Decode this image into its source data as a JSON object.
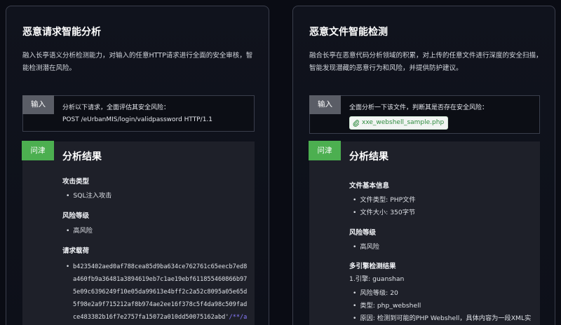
{
  "left": {
    "title": "恶意请求智能分析",
    "desc": "融入长亭语义分析检测能力，对输入的任意HTTP请求进行全面的安全审核，智能检测潜在风险。",
    "input_tag": "输入",
    "input_line1": "分析以下请求，全面评估其安全风险：",
    "input_line2": "POST /eUrbanMIS/login/validpassword HTTP/1.1",
    "answer_tag": "问津",
    "result_title": "分析结果",
    "attack_type_label": "攻击类型",
    "attack_type_value": "SQL注入攻击",
    "risk_level_label": "风险等级",
    "risk_level_value": "高风险",
    "payload_label": "请求载荷",
    "payload_value": "b4235402aed0af788cea85d9ba634ce762761c65eecb7ed8a460fb9a36481a3894619eb7c1ae19ebf611855460866b975e09c6396249f10e05da99613e4bff2c2a52c8095a05e65d5f98e2a9f715212af8b974ae2ee16f378c5f4da98c509fadce483382b16f7e2757fa15072a010dd50075162abd'",
    "payload_highlight": "/**/and("
  },
  "right": {
    "title": "恶意文件智能检测",
    "desc": "融合长亭在恶意代码分析领域的积累，对上传的任意文件进行深度的安全扫描，智能发现潜藏的恶意行为和风险，并提供防护建议。",
    "input_tag": "输入",
    "input_line1": "全面分析一下该文件，判断其是否存在安全风险：",
    "file_name": "xxe_webshell_sample.php",
    "answer_tag": "问津",
    "result_title": "分析结果",
    "file_info_label": "文件基本信息",
    "file_type": "文件类型: PHP文件",
    "file_size": "文件大小: 350字节",
    "risk_level_label": "风险等级",
    "risk_level_value": "高风险",
    "engine_label": "多引擎检测结果",
    "engine_1": "1.引擎: guanshan",
    "engine_risk": "风险等级: 20",
    "engine_type": "类型: php_webshell",
    "engine_reason": "原因: 检测到可能的PHP Webshell，具体内容为一段XML实"
  },
  "colors": {
    "background": "#0a0c14",
    "card_border": "#3a3e4c",
    "input_tag": "#5a5d66",
    "answer_tag": "#4caf50",
    "file_chip_text": "#2e8b3e",
    "payload_highlight": "#8a7cff"
  },
  "icons": {
    "file_chip": "paperclip-icon"
  }
}
